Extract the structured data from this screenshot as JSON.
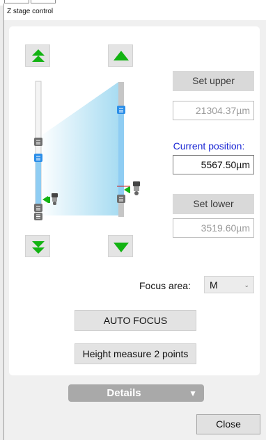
{
  "window": {
    "title": "Z stage control"
  },
  "icons": {
    "move_top": "double-up-arrow-icon",
    "step_up": "up-arrow-icon",
    "move_bottom": "double-down-arrow-icon",
    "step_down": "down-arrow-icon",
    "accent_color": "#12b312"
  },
  "stage": {
    "set_upper_label": "Set upper",
    "upper_value": "21304.37µm",
    "current_label": "Current position:",
    "current_value": "5567.50µm",
    "set_lower_label": "Set lower",
    "lower_value": "3519.60µm"
  },
  "focus": {
    "label": "Focus area:",
    "selected": "M"
  },
  "buttons": {
    "auto_focus": "AUTO FOCUS",
    "height_measure": "Height measure 2 points",
    "details": "Details",
    "close": "Close"
  }
}
